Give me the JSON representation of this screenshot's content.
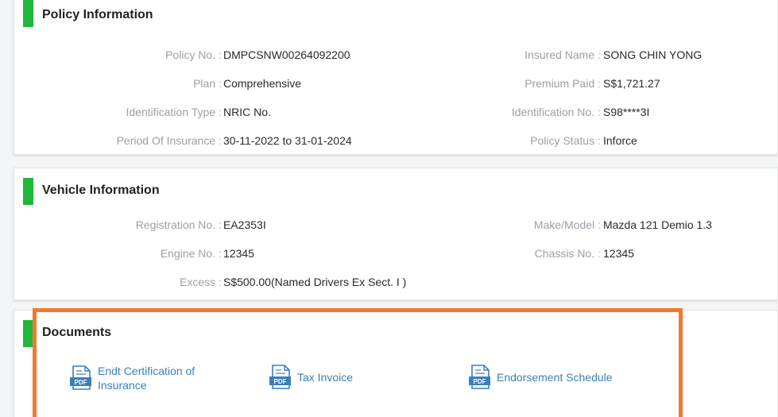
{
  "policy": {
    "title": "Policy Information",
    "rows": [
      {
        "left_label": "Policy No.",
        "left_value": "DMPCSNW00264092200",
        "right_label": "Insured Name",
        "right_value": "SONG CHIN YONG"
      },
      {
        "left_label": "Plan",
        "left_value": "Comprehensive",
        "right_label": "Premium Paid",
        "right_value": "S$1,721.27"
      },
      {
        "left_label": "Identification Type",
        "left_value": "NRIC No.",
        "right_label": "Identification No.",
        "right_value": "S98****3I"
      },
      {
        "left_label": "Period Of Insurance",
        "left_value": "30-11-2022 to 31-01-2024",
        "right_label": "Policy Status",
        "right_value": "Inforce"
      }
    ]
  },
  "vehicle": {
    "title": "Vehicle Information",
    "rows": [
      {
        "left_label": "Registration No.",
        "left_value": "EA2353I",
        "right_label": "Make/Model",
        "right_value": "Mazda 121 Demio 1.3"
      },
      {
        "left_label": "Engine No.",
        "left_value": "12345",
        "right_label": "Chassis No.",
        "right_value": "12345"
      },
      {
        "left_label": "Excess",
        "left_value": "S$500.00(Named Drivers Ex Sect. I )"
      }
    ]
  },
  "documents": {
    "title": "Documents",
    "items": [
      {
        "line1": "Endt Certification of",
        "line2": "Insurance",
        "icon": "pdf-icon"
      },
      {
        "line1": "Tax Invoice",
        "line2": "",
        "icon": "pdf-icon"
      },
      {
        "line1": "Endorsement Schedule",
        "line2": "",
        "icon": "pdf-icon"
      }
    ]
  },
  "colors": {
    "accent": "#1eb83a",
    "link": "#3b7fb8",
    "highlight": "#f07a2d"
  }
}
